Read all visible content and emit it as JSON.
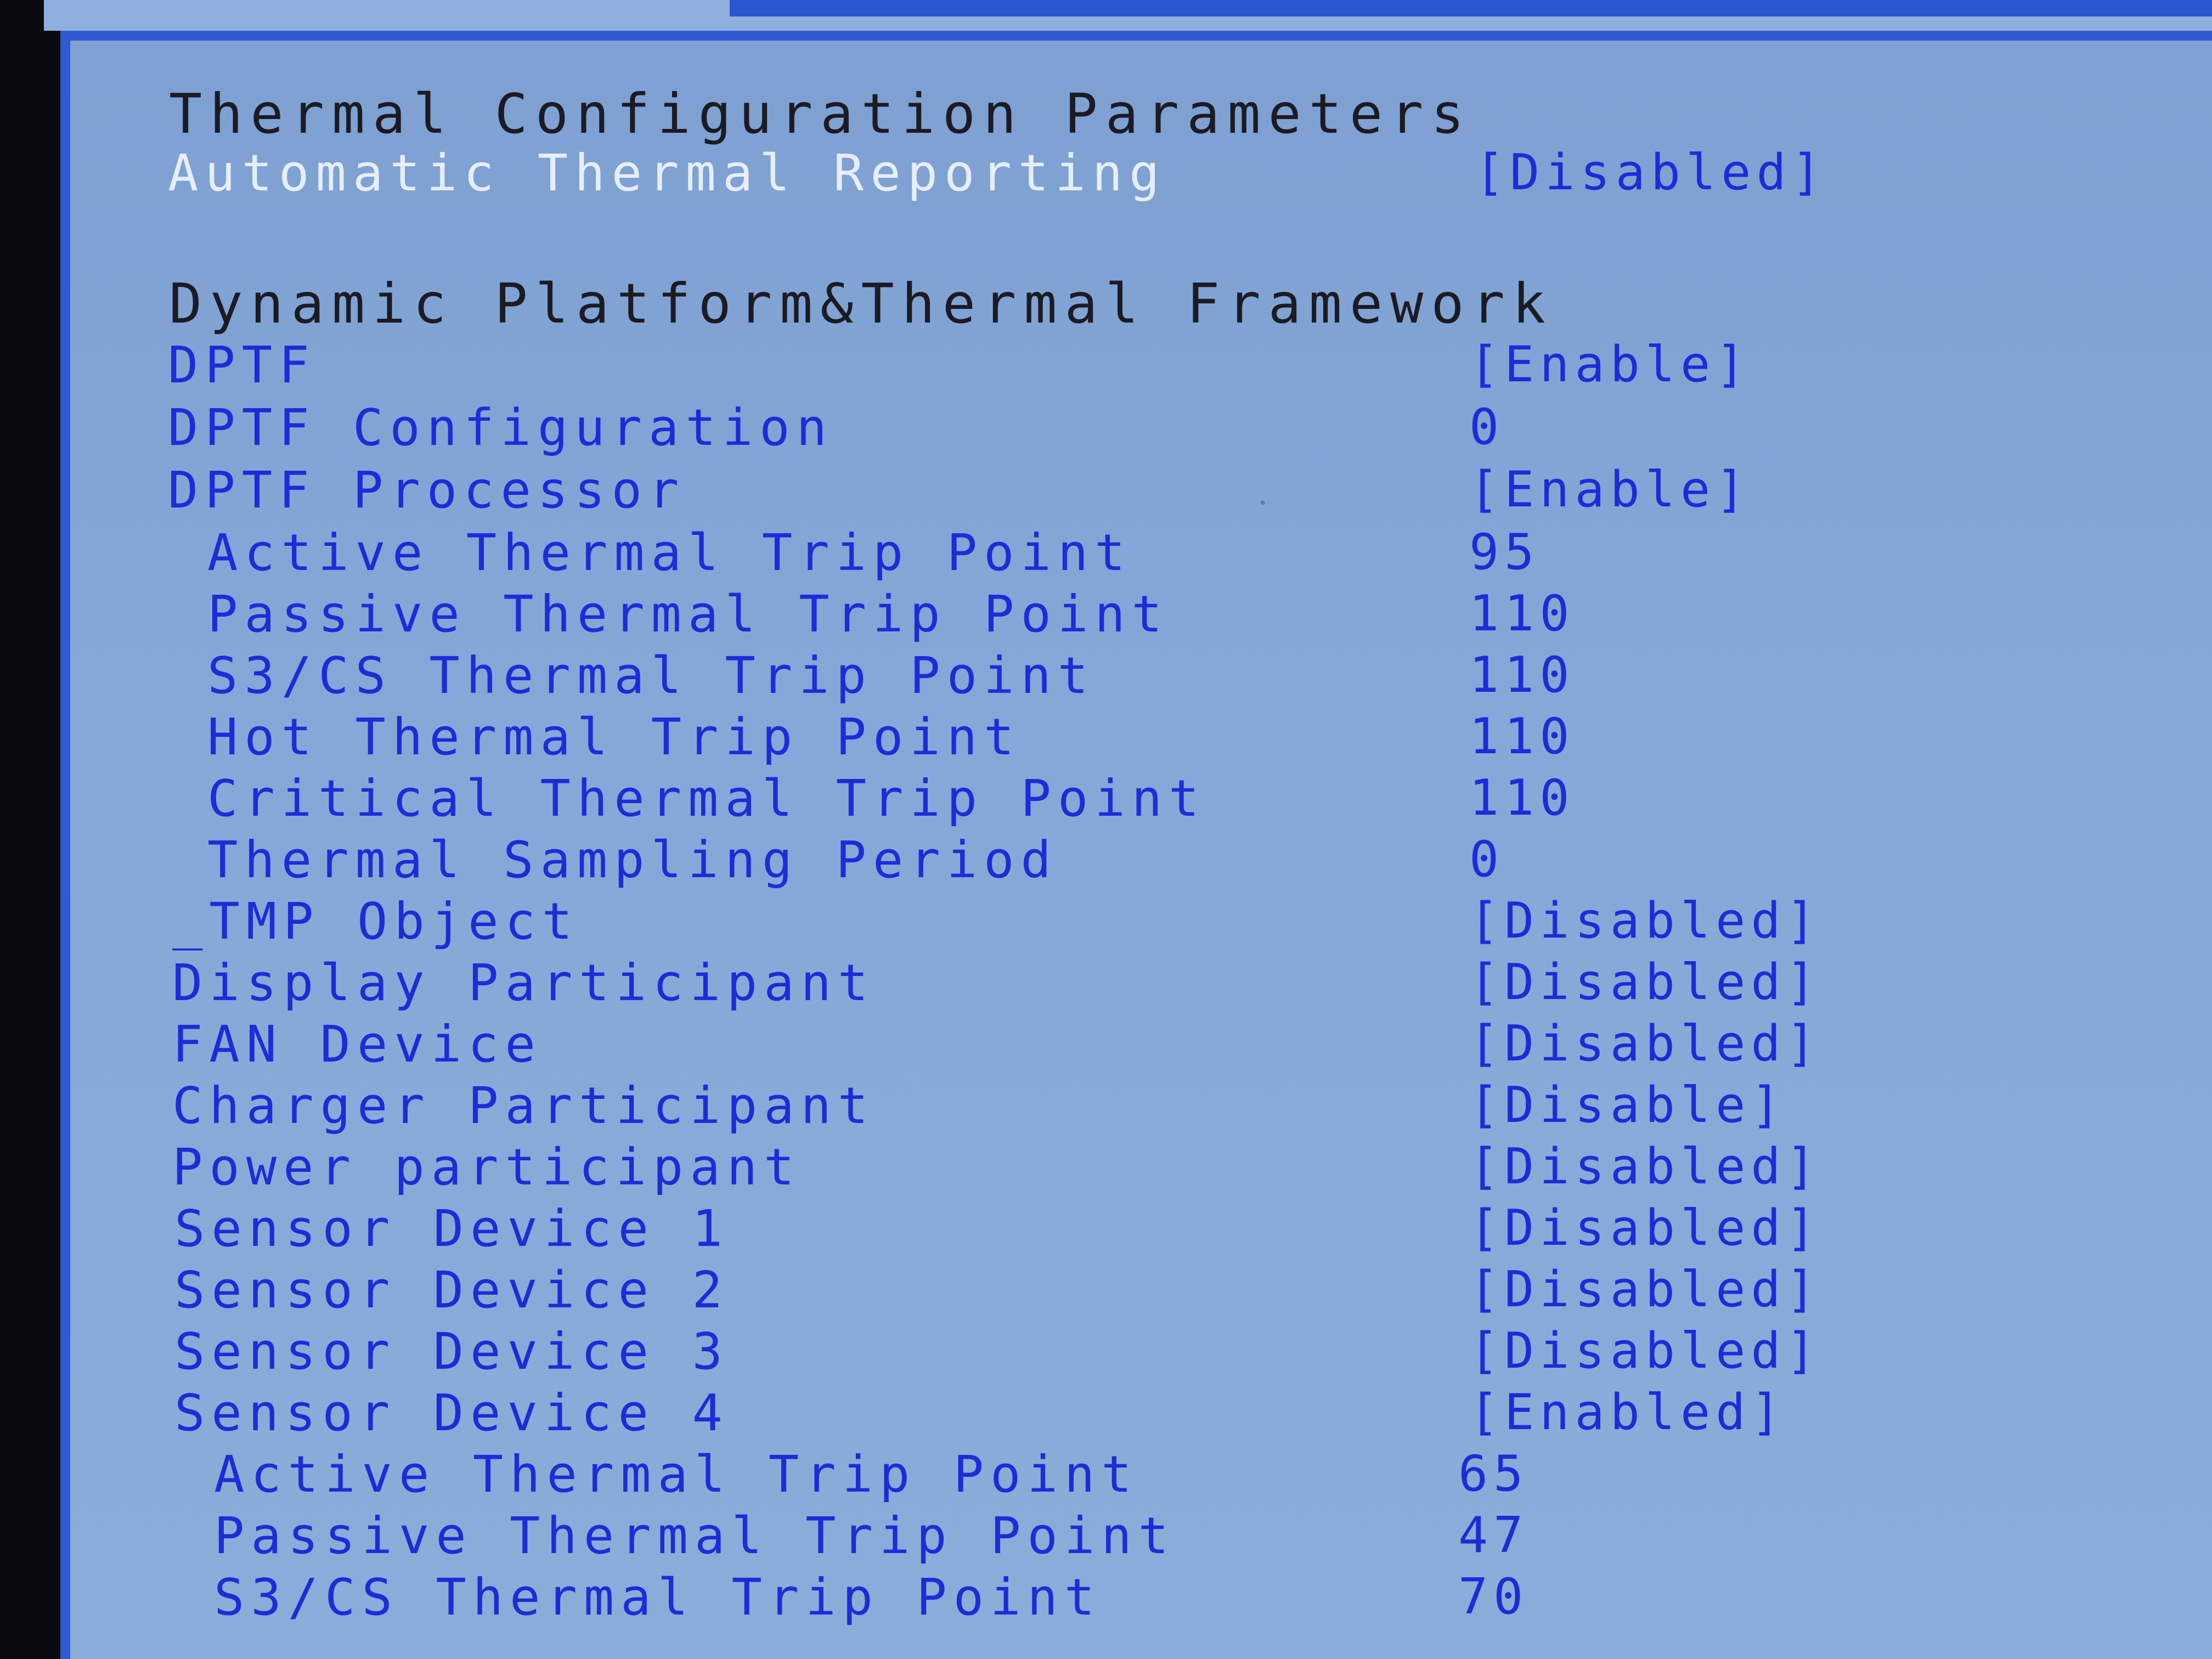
{
  "thermal_section": {
    "title": "Thermal Configuration Parameters",
    "automatic_reporting": {
      "label": "Automatic Thermal Reporting",
      "value": "[Disabled]"
    }
  },
  "dptf_section": {
    "title": "Dynamic Platform&Thermal Framework",
    "rows": [
      {
        "label": "DPTF",
        "value": "[Enable]"
      },
      {
        "label": "DPTF Configuration",
        "value": "0"
      },
      {
        "label": "DPTF Processor",
        "value": "[Enable]"
      },
      {
        "label": "Active Thermal Trip Point",
        "value": "95"
      },
      {
        "label": "Passive Thermal Trip Point",
        "value": "110"
      },
      {
        "label": "S3/CS Thermal Trip Point",
        "value": "110"
      },
      {
        "label": "Hot Thermal Trip Point",
        "value": "110"
      },
      {
        "label": "Critical Thermal Trip Point",
        "value": "110"
      },
      {
        "label": "Thermal Sampling Period",
        "value": "0"
      },
      {
        "label": "_TMP Object",
        "value": "[Disabled]"
      },
      {
        "label": "Display Participant",
        "value": "[Disabled]"
      },
      {
        "label": "FAN Device",
        "value": "[Disabled]"
      },
      {
        "label": "Charger Participant",
        "value": "[Disable]"
      },
      {
        "label": "Power participant",
        "value": "[Disabled]"
      },
      {
        "label": "Sensor Device 1",
        "value": "[Disabled]"
      },
      {
        "label": "Sensor Device 2",
        "value": "[Disabled]"
      },
      {
        "label": "Sensor Device 3",
        "value": "[Disabled]"
      },
      {
        "label": "Sensor Device 4",
        "value": "[Enabled]"
      },
      {
        "label": "Active Thermal Trip Point",
        "value": "65"
      },
      {
        "label": "Passive Thermal Trip Point",
        "value": "47"
      },
      {
        "label": "S3/CS Thermal Trip Point",
        "value": "70"
      }
    ]
  },
  "colors": {
    "background": "#84a6d6",
    "frame": "#2f5ad4",
    "option_text": "#1c2cd8",
    "header_text": "#1b1b24",
    "highlight_text": "#e6eeff"
  }
}
